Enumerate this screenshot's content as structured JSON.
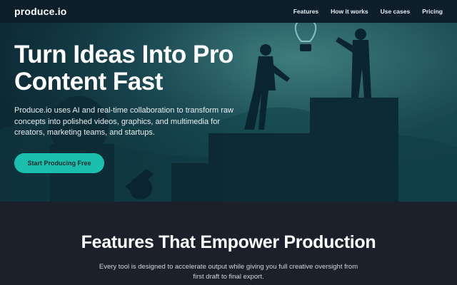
{
  "brand": {
    "name": "produce.io"
  },
  "nav": {
    "items": [
      "Features",
      "How it works",
      "Use cases",
      "Pricing"
    ]
  },
  "hero": {
    "title": "Turn Ideas Into Pro Content Fast",
    "description": "Produce.io uses AI and real-time collaboration to transform raw concepts into polished videos, graphics, and multimedia for creators, marketing teams, and startups.",
    "cta_label": "Start Producing Free"
  },
  "features": {
    "title": "Features That Empower Production",
    "subtitle": "Every tool is designed to accelerate output while giving you full creative oversight from first draft to final export."
  },
  "colors": {
    "accent": "#1bbfae",
    "topbar": "#0c1e2a",
    "hero_bg": "#0f3a44",
    "section_bg": "#1c202b"
  }
}
